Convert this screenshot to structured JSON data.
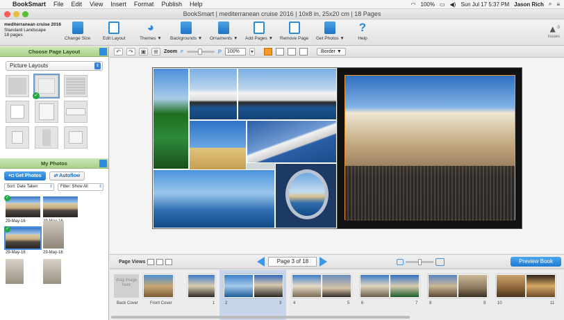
{
  "menubar": {
    "app": "BookSmart",
    "items": [
      "File",
      "Edit",
      "View",
      "Insert",
      "Format",
      "Publish",
      "Help"
    ],
    "battery": "100%",
    "datetime": "Sun Jul 17  5:37 PM",
    "user": "Jason Rich"
  },
  "window": {
    "title": "BookSmart  |  mediterranean cruise 2016  |  10x8 in, 25x20 cm  |  18 Pages"
  },
  "project": {
    "name": "mediterranean cruise 2016",
    "format": "Standard Landscape",
    "pages": "18 pages"
  },
  "toolbar": {
    "change_size": "Change Size",
    "edit_layout": "Edit Layout",
    "themes": "Themes ▼",
    "backgrounds": "Backgrounds ▼",
    "ornaments": "Ornaments ▼",
    "add_pages": "Add Pages ▼",
    "remove_page": "Remove Page",
    "get_photos": "Get Photos ▼",
    "help": "Help",
    "issues_count": "0",
    "issues_label": "Issues"
  },
  "left": {
    "layout_header": "Choose Page Layout",
    "layout_select": "Picture Layouts",
    "photos_header": "My Photos",
    "get_photos": "Get Photos",
    "autoflow": "Autoflow",
    "sort": "Sort: Date Taken",
    "filter": "Filter: Show All",
    "photo_labels": [
      "29-May-16",
      "29-May-16",
      "29-May-16",
      "29-May-16"
    ]
  },
  "controls": {
    "zoom_label": "Zoom",
    "zoom_value": "100%",
    "border": "Border ▼"
  },
  "pageviews": {
    "label": "Page Views",
    "indicator": "Page 3 of 18",
    "preview": "Preview Book"
  },
  "thumbs": {
    "drag_text": "drag image here",
    "back_cover": "Back Cover",
    "front_cover": "Front Cover",
    "page_numbers": [
      "1",
      "2",
      "3",
      "4",
      "5",
      "6",
      "7",
      "8",
      "9",
      "10",
      "11"
    ]
  },
  "colors": {
    "accent": "#2f8de0",
    "selected_orange": "#f39a2a",
    "panel_green": "#a9d08a"
  }
}
